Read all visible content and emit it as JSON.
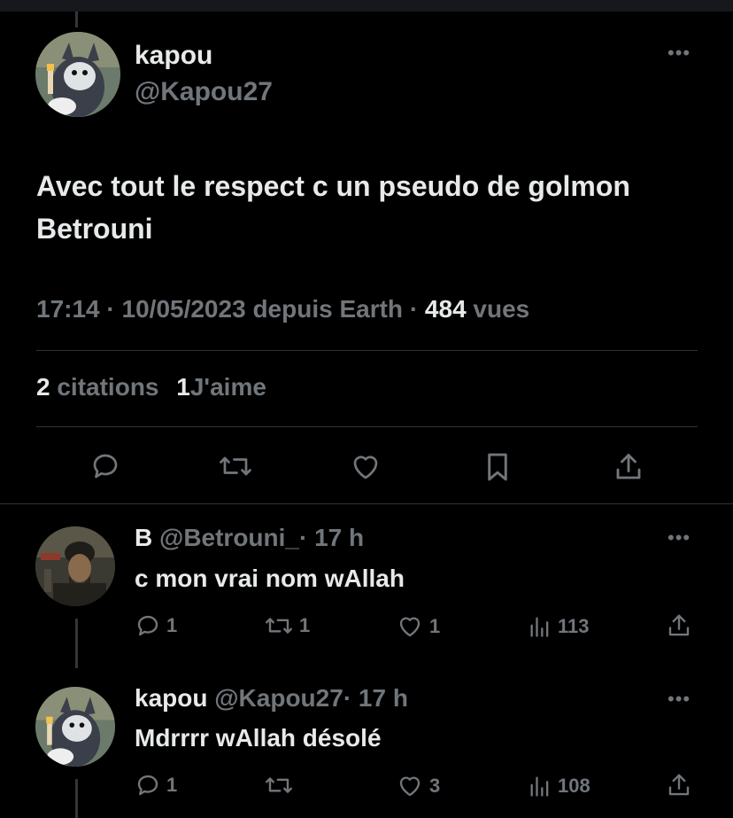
{
  "main_tweet": {
    "author_name": "kapou",
    "author_handle": "@Kapou27",
    "text": "Avec tout le respect c un pseudo de golmon Betrouni",
    "time": "17:14",
    "date": "10/05/2023",
    "source": "depuis Earth",
    "views_count": "484",
    "views_label": "vues",
    "quotes_count": "2",
    "quotes_label": "citations",
    "likes_count": "1",
    "likes_label": "J'aime",
    "separator": "·"
  },
  "replies": [
    {
      "author_name": "B",
      "author_handle": "@Betrouni_",
      "time": "· 17 h",
      "text": "c mon vrai nom wAllah",
      "replies": "1",
      "retweets": "1",
      "likes": "1",
      "views": "113"
    },
    {
      "author_name": "kapou",
      "author_handle": "@Kapou27",
      "time": "· 17 h",
      "text": "Mdrrrr wAllah désolé",
      "replies": "1",
      "retweets": "",
      "likes": "3",
      "views": "108"
    }
  ],
  "icons": {
    "more": "more-icon",
    "reply": "reply-icon",
    "retweet": "retweet-icon",
    "like": "like-icon",
    "bookmark": "bookmark-icon",
    "share": "share-icon",
    "views": "views-icon"
  },
  "colors": {
    "background": "#000000",
    "text": "#e7e9ea",
    "muted": "#71767b",
    "divider": "#2f3336"
  }
}
